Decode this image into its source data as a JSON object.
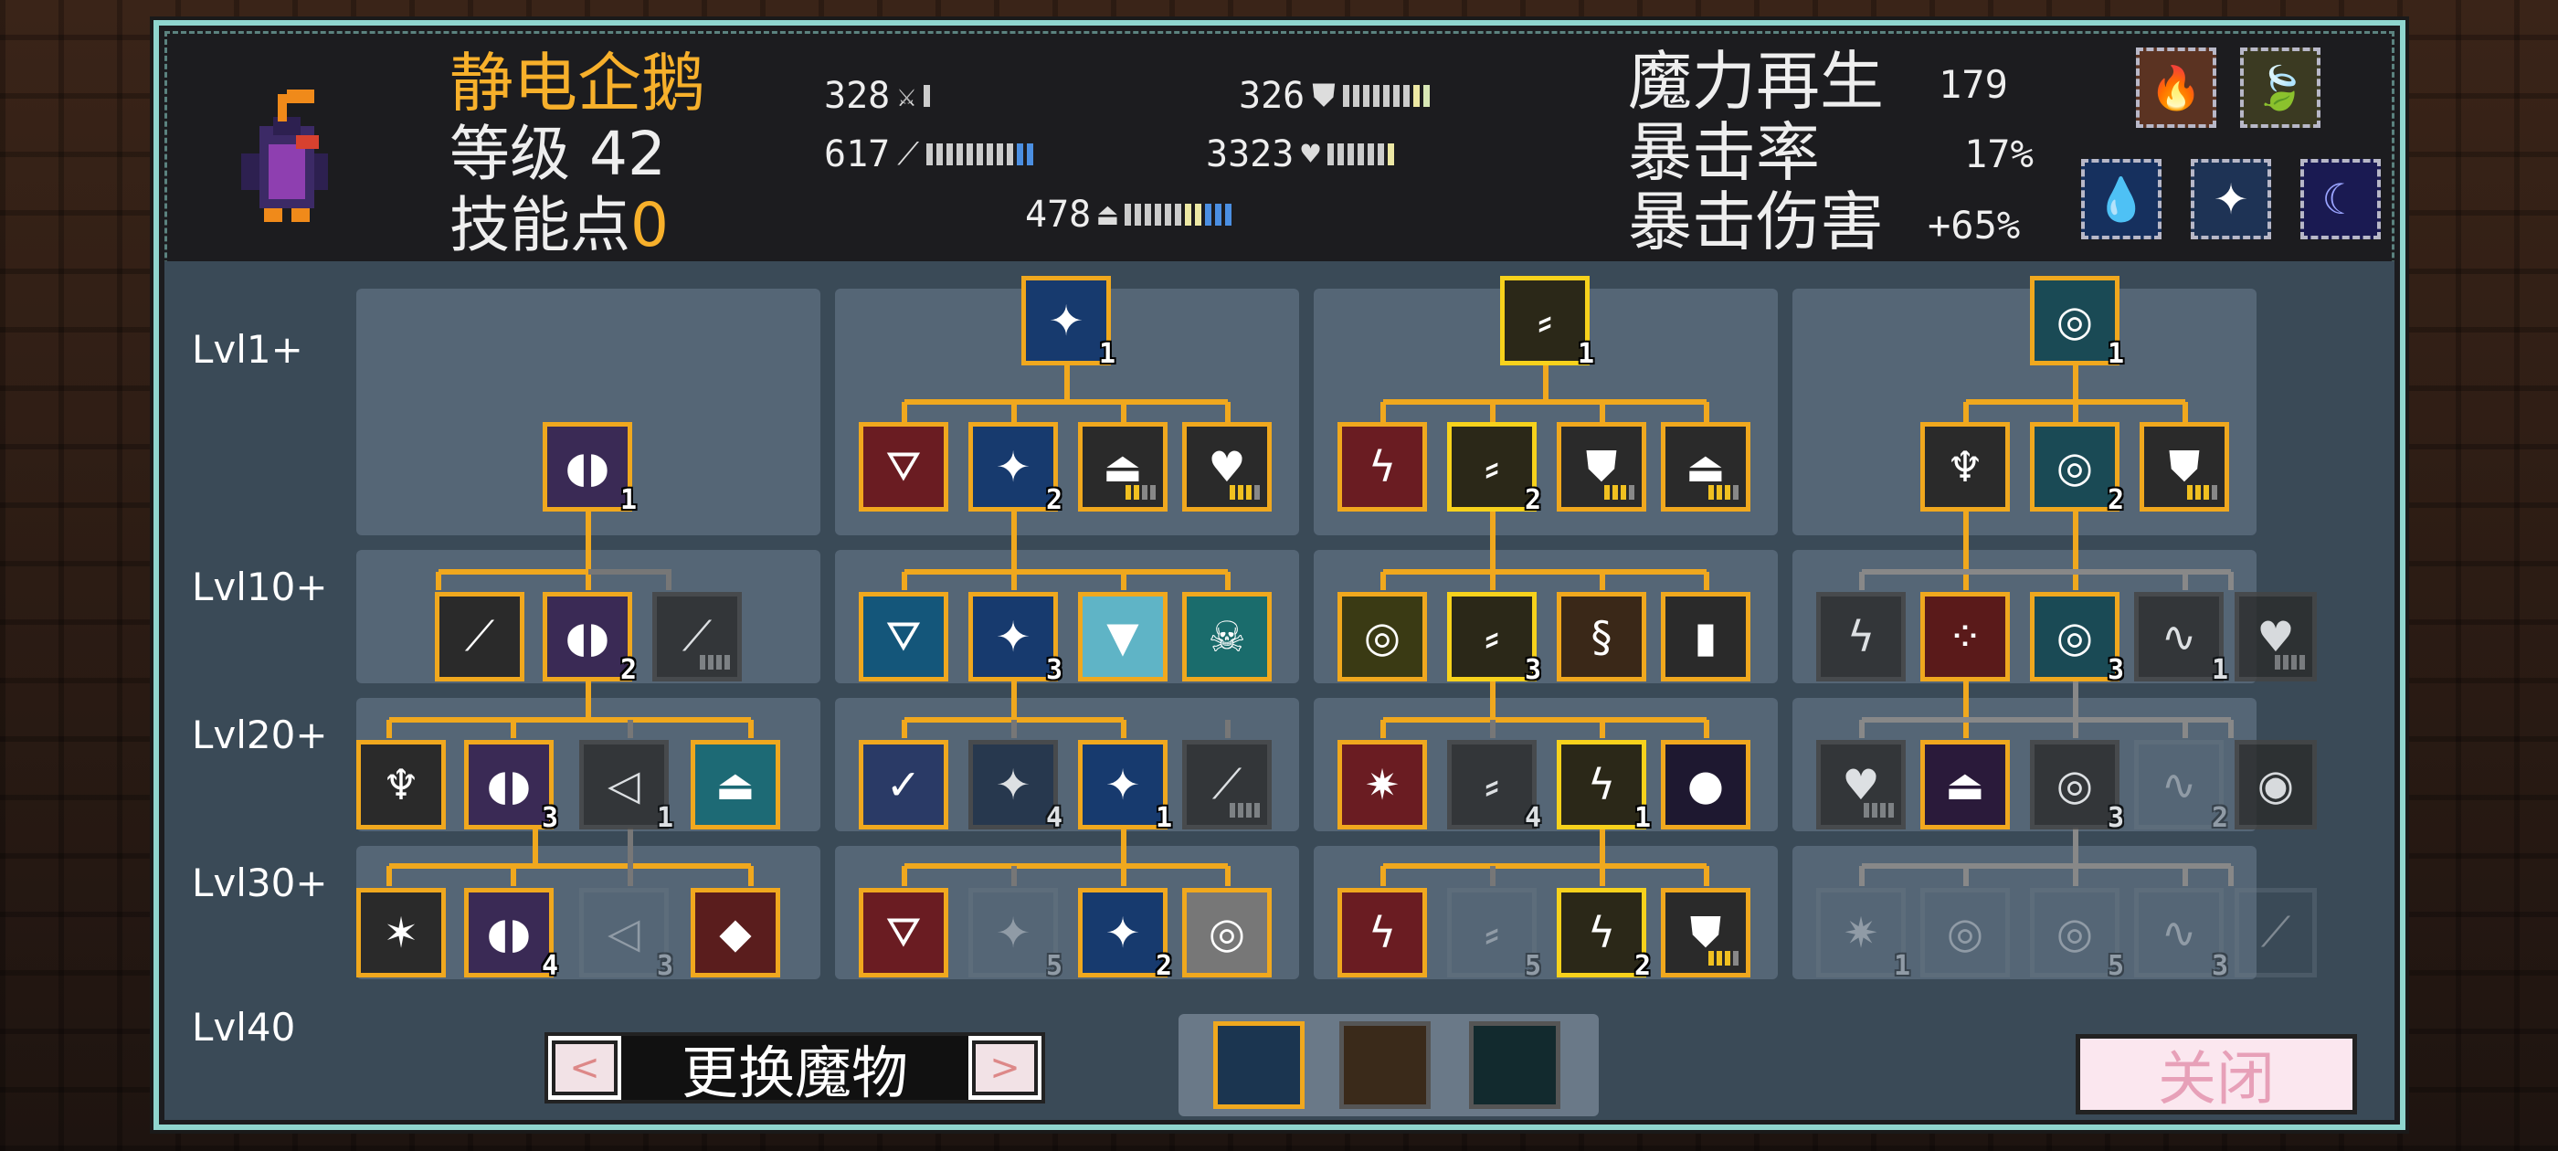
{
  "character": {
    "name": "静电企鹅",
    "level_label": "等级",
    "level_value": "42",
    "skill_points_label": "技能点",
    "skill_points_value": "0"
  },
  "stats": {
    "attack": "328",
    "defense": "326",
    "magic_attack": "617",
    "health": "3323",
    "mana": "478"
  },
  "right_stats": {
    "mana_regen_label": "魔力再生",
    "mana_regen_value": "179",
    "crit_rate_label": "暴击率",
    "crit_rate_value": "17%",
    "crit_damage_label": "暴击伤害",
    "crit_damage_value": "+65%"
  },
  "buff_icons": [
    "fire-up-icon",
    "leaf-up-icon",
    "water-shield-icon",
    "light-shield-icon",
    "moon-icon"
  ],
  "level_rows": [
    "Lvl1+",
    "Lvl10+",
    "Lvl20+",
    "Lvl30+",
    "Lvl40"
  ],
  "node_badges": {
    "c1": [
      "1",
      "2",
      "3",
      "1",
      "4",
      "3"
    ],
    "c2": [
      "1",
      "2",
      "3",
      "4",
      "1",
      "5",
      "2"
    ],
    "c3": [
      "1",
      "2",
      "3",
      "4",
      "1",
      "5",
      "2"
    ],
    "c4": [
      "1",
      "2",
      "3",
      "1",
      "3",
      "2",
      "1",
      "5",
      "3"
    ]
  },
  "bottom": {
    "prev_label": "<",
    "next_label": ">",
    "swap_label": "更换魔物",
    "close_label": "关闭"
  },
  "colors": {
    "accent_orange": "#f7b02b",
    "node_border": "#f0a81e",
    "panel_border": "#8fd6cf"
  }
}
